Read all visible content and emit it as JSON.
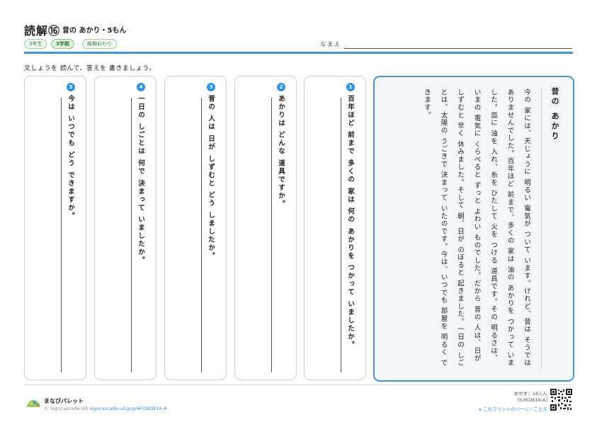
{
  "header": {
    "title": "読解⑯",
    "subtitle": "昔の あかり・5もん",
    "tags": [
      "3年生",
      "3学期",
      "後期おわり"
    ],
    "name_label": "なまえ"
  },
  "instruction": "文しょうを 読んで、答えを 書きましょう。",
  "story": {
    "title": "昔の あかり",
    "paragraphs": [
      "今の 家には、天じょうに 明るい 電気が ついて います。けれど、昔は そうでは ありませんでした。百年ほど 前まで、多くの 家は 油の あかりを つかって いました。皿に 油を 入れ、糸を ひたして 火を つける 道具です。その 明るさは、いまの 電気に くらべると ずっと よわい ものでした。だから 昔の 人は、日が しずむと 早く 休みました。そして 朝、日が のぼると 起きました。一日の しごとは、太陽の うごきで 決まって いたのです。今は、いつでも 部屋を 明るく できます。"
    ]
  },
  "questions": [
    {
      "number": "1",
      "text": "百年ほど 前まで 多くの 家は 何の あかりを つかって いましたか。"
    },
    {
      "number": "2",
      "text": "あかりは どんな 道具ですか。"
    },
    {
      "number": "3",
      "text": "昔の 人は 日が しずむと どう しましたか。"
    },
    {
      "number": "4",
      "text": "一日の しごとは 何で 決まって いましたか。"
    },
    {
      "number": "5",
      "text": "今は いつでも どう できますか。"
    }
  ],
  "footer": {
    "brand": "まなびパレット",
    "copyright": "© SignCascade UD",
    "url": "signcascade-ud.jp/p/#S3KDK16-A",
    "time": "めやす：18ふん",
    "code": "[S3KDK16-A]",
    "page_link": "▸ このプリントのページ／こたえ"
  },
  "colors": {
    "accent": "#3e99df",
    "question_badge": "#2f93e6",
    "tag_green": "#3b7a3e"
  }
}
